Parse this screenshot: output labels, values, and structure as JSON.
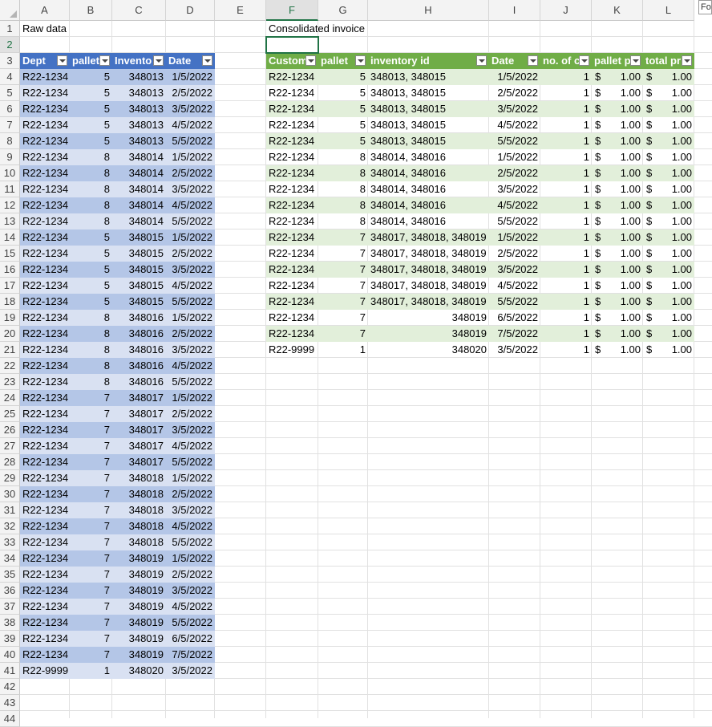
{
  "columns": [
    "A",
    "B",
    "C",
    "D",
    "E",
    "F",
    "G",
    "H",
    "I",
    "J",
    "K",
    "L"
  ],
  "rows": [
    1,
    2,
    3,
    4,
    5,
    6,
    7,
    8,
    9,
    10,
    11,
    12,
    13,
    14,
    15,
    16,
    17,
    18,
    19,
    20,
    21,
    22,
    23,
    24,
    25,
    26,
    27,
    28,
    29,
    30,
    31,
    32,
    33,
    34,
    35,
    36,
    37,
    38,
    39,
    40,
    41,
    42,
    43,
    44
  ],
  "corner_tab": "Fo",
  "raw_title": "Raw data",
  "invoice_title": "Consolidated invoice",
  "raw_headers": [
    "Dept",
    "pallet",
    "Invento",
    "Date"
  ],
  "raw_rows": [
    [
      "R22-1234",
      "5",
      "348013",
      "1/5/2022"
    ],
    [
      "R22-1234",
      "5",
      "348013",
      "2/5/2022"
    ],
    [
      "R22-1234",
      "5",
      "348013",
      "3/5/2022"
    ],
    [
      "R22-1234",
      "5",
      "348013",
      "4/5/2022"
    ],
    [
      "R22-1234",
      "5",
      "348013",
      "5/5/2022"
    ],
    [
      "R22-1234",
      "8",
      "348014",
      "1/5/2022"
    ],
    [
      "R22-1234",
      "8",
      "348014",
      "2/5/2022"
    ],
    [
      "R22-1234",
      "8",
      "348014",
      "3/5/2022"
    ],
    [
      "R22-1234",
      "8",
      "348014",
      "4/5/2022"
    ],
    [
      "R22-1234",
      "8",
      "348014",
      "5/5/2022"
    ],
    [
      "R22-1234",
      "5",
      "348015",
      "1/5/2022"
    ],
    [
      "R22-1234",
      "5",
      "348015",
      "2/5/2022"
    ],
    [
      "R22-1234",
      "5",
      "348015",
      "3/5/2022"
    ],
    [
      "R22-1234",
      "5",
      "348015",
      "4/5/2022"
    ],
    [
      "R22-1234",
      "5",
      "348015",
      "5/5/2022"
    ],
    [
      "R22-1234",
      "8",
      "348016",
      "1/5/2022"
    ],
    [
      "R22-1234",
      "8",
      "348016",
      "2/5/2022"
    ],
    [
      "R22-1234",
      "8",
      "348016",
      "3/5/2022"
    ],
    [
      "R22-1234",
      "8",
      "348016",
      "4/5/2022"
    ],
    [
      "R22-1234",
      "8",
      "348016",
      "5/5/2022"
    ],
    [
      "R22-1234",
      "7",
      "348017",
      "1/5/2022"
    ],
    [
      "R22-1234",
      "7",
      "348017",
      "2/5/2022"
    ],
    [
      "R22-1234",
      "7",
      "348017",
      "3/5/2022"
    ],
    [
      "R22-1234",
      "7",
      "348017",
      "4/5/2022"
    ],
    [
      "R22-1234",
      "7",
      "348017",
      "5/5/2022"
    ],
    [
      "R22-1234",
      "7",
      "348018",
      "1/5/2022"
    ],
    [
      "R22-1234",
      "7",
      "348018",
      "2/5/2022"
    ],
    [
      "R22-1234",
      "7",
      "348018",
      "3/5/2022"
    ],
    [
      "R22-1234",
      "7",
      "348018",
      "4/5/2022"
    ],
    [
      "R22-1234",
      "7",
      "348018",
      "5/5/2022"
    ],
    [
      "R22-1234",
      "7",
      "348019",
      "1/5/2022"
    ],
    [
      "R22-1234",
      "7",
      "348019",
      "2/5/2022"
    ],
    [
      "R22-1234",
      "7",
      "348019",
      "3/5/2022"
    ],
    [
      "R22-1234",
      "7",
      "348019",
      "4/5/2022"
    ],
    [
      "R22-1234",
      "7",
      "348019",
      "5/5/2022"
    ],
    [
      "R22-1234",
      "7",
      "348019",
      "6/5/2022"
    ],
    [
      "R22-1234",
      "7",
      "348019",
      "7/5/2022"
    ],
    [
      "R22-9999",
      "1",
      "348020",
      "3/5/2022"
    ]
  ],
  "inv_headers": [
    "Custom",
    "pallet",
    "inventory id",
    "Date",
    "no. of c",
    "pallet p",
    "total pr"
  ],
  "inv_rows": [
    [
      "R22-1234",
      "5",
      "348013, 348015",
      "1/5/2022",
      "1",
      "$",
      "1.00",
      "$",
      "1.00"
    ],
    [
      "R22-1234",
      "5",
      "348013, 348015",
      "2/5/2022",
      "1",
      "$",
      "1.00",
      "$",
      "1.00"
    ],
    [
      "R22-1234",
      "5",
      "348013, 348015",
      "3/5/2022",
      "1",
      "$",
      "1.00",
      "$",
      "1.00"
    ],
    [
      "R22-1234",
      "5",
      "348013, 348015",
      "4/5/2022",
      "1",
      "$",
      "1.00",
      "$",
      "1.00"
    ],
    [
      "R22-1234",
      "5",
      "348013, 348015",
      "5/5/2022",
      "1",
      "$",
      "1.00",
      "$",
      "1.00"
    ],
    [
      "R22-1234",
      "8",
      "348014, 348016",
      "1/5/2022",
      "1",
      "$",
      "1.00",
      "$",
      "1.00"
    ],
    [
      "R22-1234",
      "8",
      "348014, 348016",
      "2/5/2022",
      "1",
      "$",
      "1.00",
      "$",
      "1.00"
    ],
    [
      "R22-1234",
      "8",
      "348014, 348016",
      "3/5/2022",
      "1",
      "$",
      "1.00",
      "$",
      "1.00"
    ],
    [
      "R22-1234",
      "8",
      "348014, 348016",
      "4/5/2022",
      "1",
      "$",
      "1.00",
      "$",
      "1.00"
    ],
    [
      "R22-1234",
      "8",
      "348014, 348016",
      "5/5/2022",
      "1",
      "$",
      "1.00",
      "$",
      "1.00"
    ],
    [
      "R22-1234",
      "7",
      "348017, 348018, 348019",
      "1/5/2022",
      "1",
      "$",
      "1.00",
      "$",
      "1.00"
    ],
    [
      "R22-1234",
      "7",
      "348017, 348018, 348019",
      "2/5/2022",
      "1",
      "$",
      "1.00",
      "$",
      "1.00"
    ],
    [
      "R22-1234",
      "7",
      "348017, 348018, 348019",
      "3/5/2022",
      "1",
      "$",
      "1.00",
      "$",
      "1.00"
    ],
    [
      "R22-1234",
      "7",
      "348017, 348018, 348019",
      "4/5/2022",
      "1",
      "$",
      "1.00",
      "$",
      "1.00"
    ],
    [
      "R22-1234",
      "7",
      "348017, 348018, 348019",
      "5/5/2022",
      "1",
      "$",
      "1.00",
      "$",
      "1.00"
    ],
    [
      "R22-1234",
      "7",
      "348019",
      "6/5/2022",
      "1",
      "$",
      "1.00",
      "$",
      "1.00"
    ],
    [
      "R22-1234",
      "7",
      "348019",
      "7/5/2022",
      "1",
      "$",
      "1.00",
      "$",
      "1.00"
    ],
    [
      "R22-9999",
      "1",
      "348020",
      "3/5/2022",
      "1",
      "$",
      "1.00",
      "$",
      "1.00"
    ]
  ],
  "colors": {
    "blue_header": "#4472c4",
    "blue_band": "#d9e1f2",
    "blue_band_dark": "#b4c6e7",
    "green_header": "#70ad47",
    "green_band": "#e2efda",
    "selection": "#217346"
  }
}
